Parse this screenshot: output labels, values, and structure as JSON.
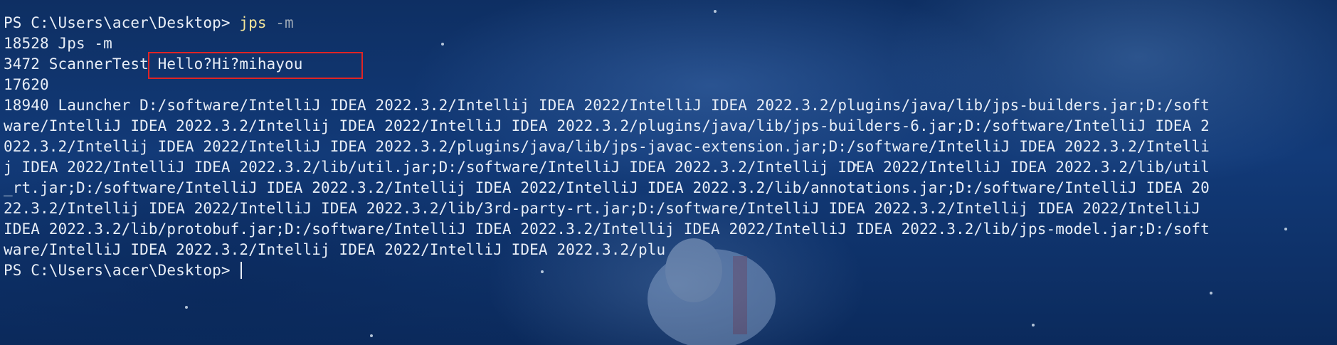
{
  "terminal": {
    "line1": {
      "prompt": "PS C:\\Users\\acer\\Desktop> ",
      "command": "jps",
      "args": " -m"
    },
    "line2": "18528 Jps -m",
    "line3": {
      "prefix": "3472 ScannerTest ",
      "highlighted": "Hello?Hi?mihayou"
    },
    "line4": "17620",
    "output_lines": [
      "18940 Launcher D:/software/IntelliJ IDEA 2022.3.2/Intellij IDEA 2022/IntelliJ IDEA 2022.3.2/plugins/java/lib/jps-builders.jar;D:/soft",
      "ware/IntelliJ IDEA 2022.3.2/Intellij IDEA 2022/IntelliJ IDEA 2022.3.2/plugins/java/lib/jps-builders-6.jar;D:/software/IntelliJ IDEA 2",
      "022.3.2/Intellij IDEA 2022/IntelliJ IDEA 2022.3.2/plugins/java/lib/jps-javac-extension.jar;D:/software/IntelliJ IDEA 2022.3.2/Intelli",
      "j IDEA 2022/IntelliJ IDEA 2022.3.2/lib/util.jar;D:/software/IntelliJ IDEA 2022.3.2/Intellij IDEA 2022/IntelliJ IDEA 2022.3.2/lib/util",
      "_rt.jar;D:/software/IntelliJ IDEA 2022.3.2/Intellij IDEA 2022/IntelliJ IDEA 2022.3.2/lib/annotations.jar;D:/software/IntelliJ IDEA 20",
      "22.3.2/Intellij IDEA 2022/IntelliJ IDEA 2022.3.2/lib/3rd-party-rt.jar;D:/software/IntelliJ IDEA 2022.3.2/Intellij IDEA 2022/IntelliJ",
      "IDEA 2022.3.2/lib/protobuf.jar;D:/software/IntelliJ IDEA 2022.3.2/Intellij IDEA 2022/IntelliJ IDEA 2022.3.2/lib/jps-model.jar;D:/soft",
      "ware/IntelliJ IDEA 2022.3.2/Intellij IDEA 2022/IntelliJ IDEA 2022.3.2/plu"
    ],
    "final_prompt": "PS C:\\Users\\acer\\Desktop> "
  },
  "colors": {
    "background": "#0d2a57",
    "text": "#e8eef7",
    "command": "#f3e59a",
    "argument": "#9aa6b5",
    "annotation_box": "#e02424"
  }
}
